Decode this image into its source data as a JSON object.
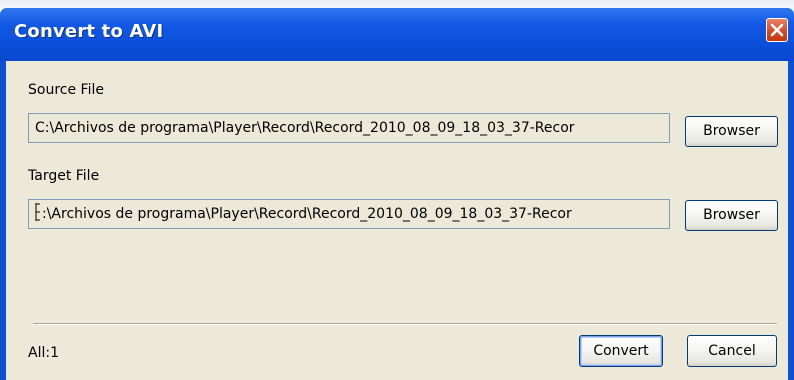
{
  "window": {
    "title": "Convert to AVI"
  },
  "source": {
    "label": "Source File",
    "value": "C:\\Archivos de programa\\Player\\Record\\Record_2010_08_09_18_03_37-Recor",
    "browse_label": "Browser"
  },
  "target": {
    "label": "Target File",
    "value": ":\\Archivos de programa\\Player\\Record\\Record_2010_08_09_18_03_37-Recor",
    "browse_label": "Browser"
  },
  "footer": {
    "status": "All:1",
    "convert_label": "Convert",
    "cancel_label": "Cancel"
  },
  "colors": {
    "titlebar": "#0b4fd8",
    "client_bg": "#ece9d8",
    "close_button": "#d2471f"
  },
  "icons": {
    "close": "close-icon",
    "text_cursor": "text-cursor-icon"
  }
}
